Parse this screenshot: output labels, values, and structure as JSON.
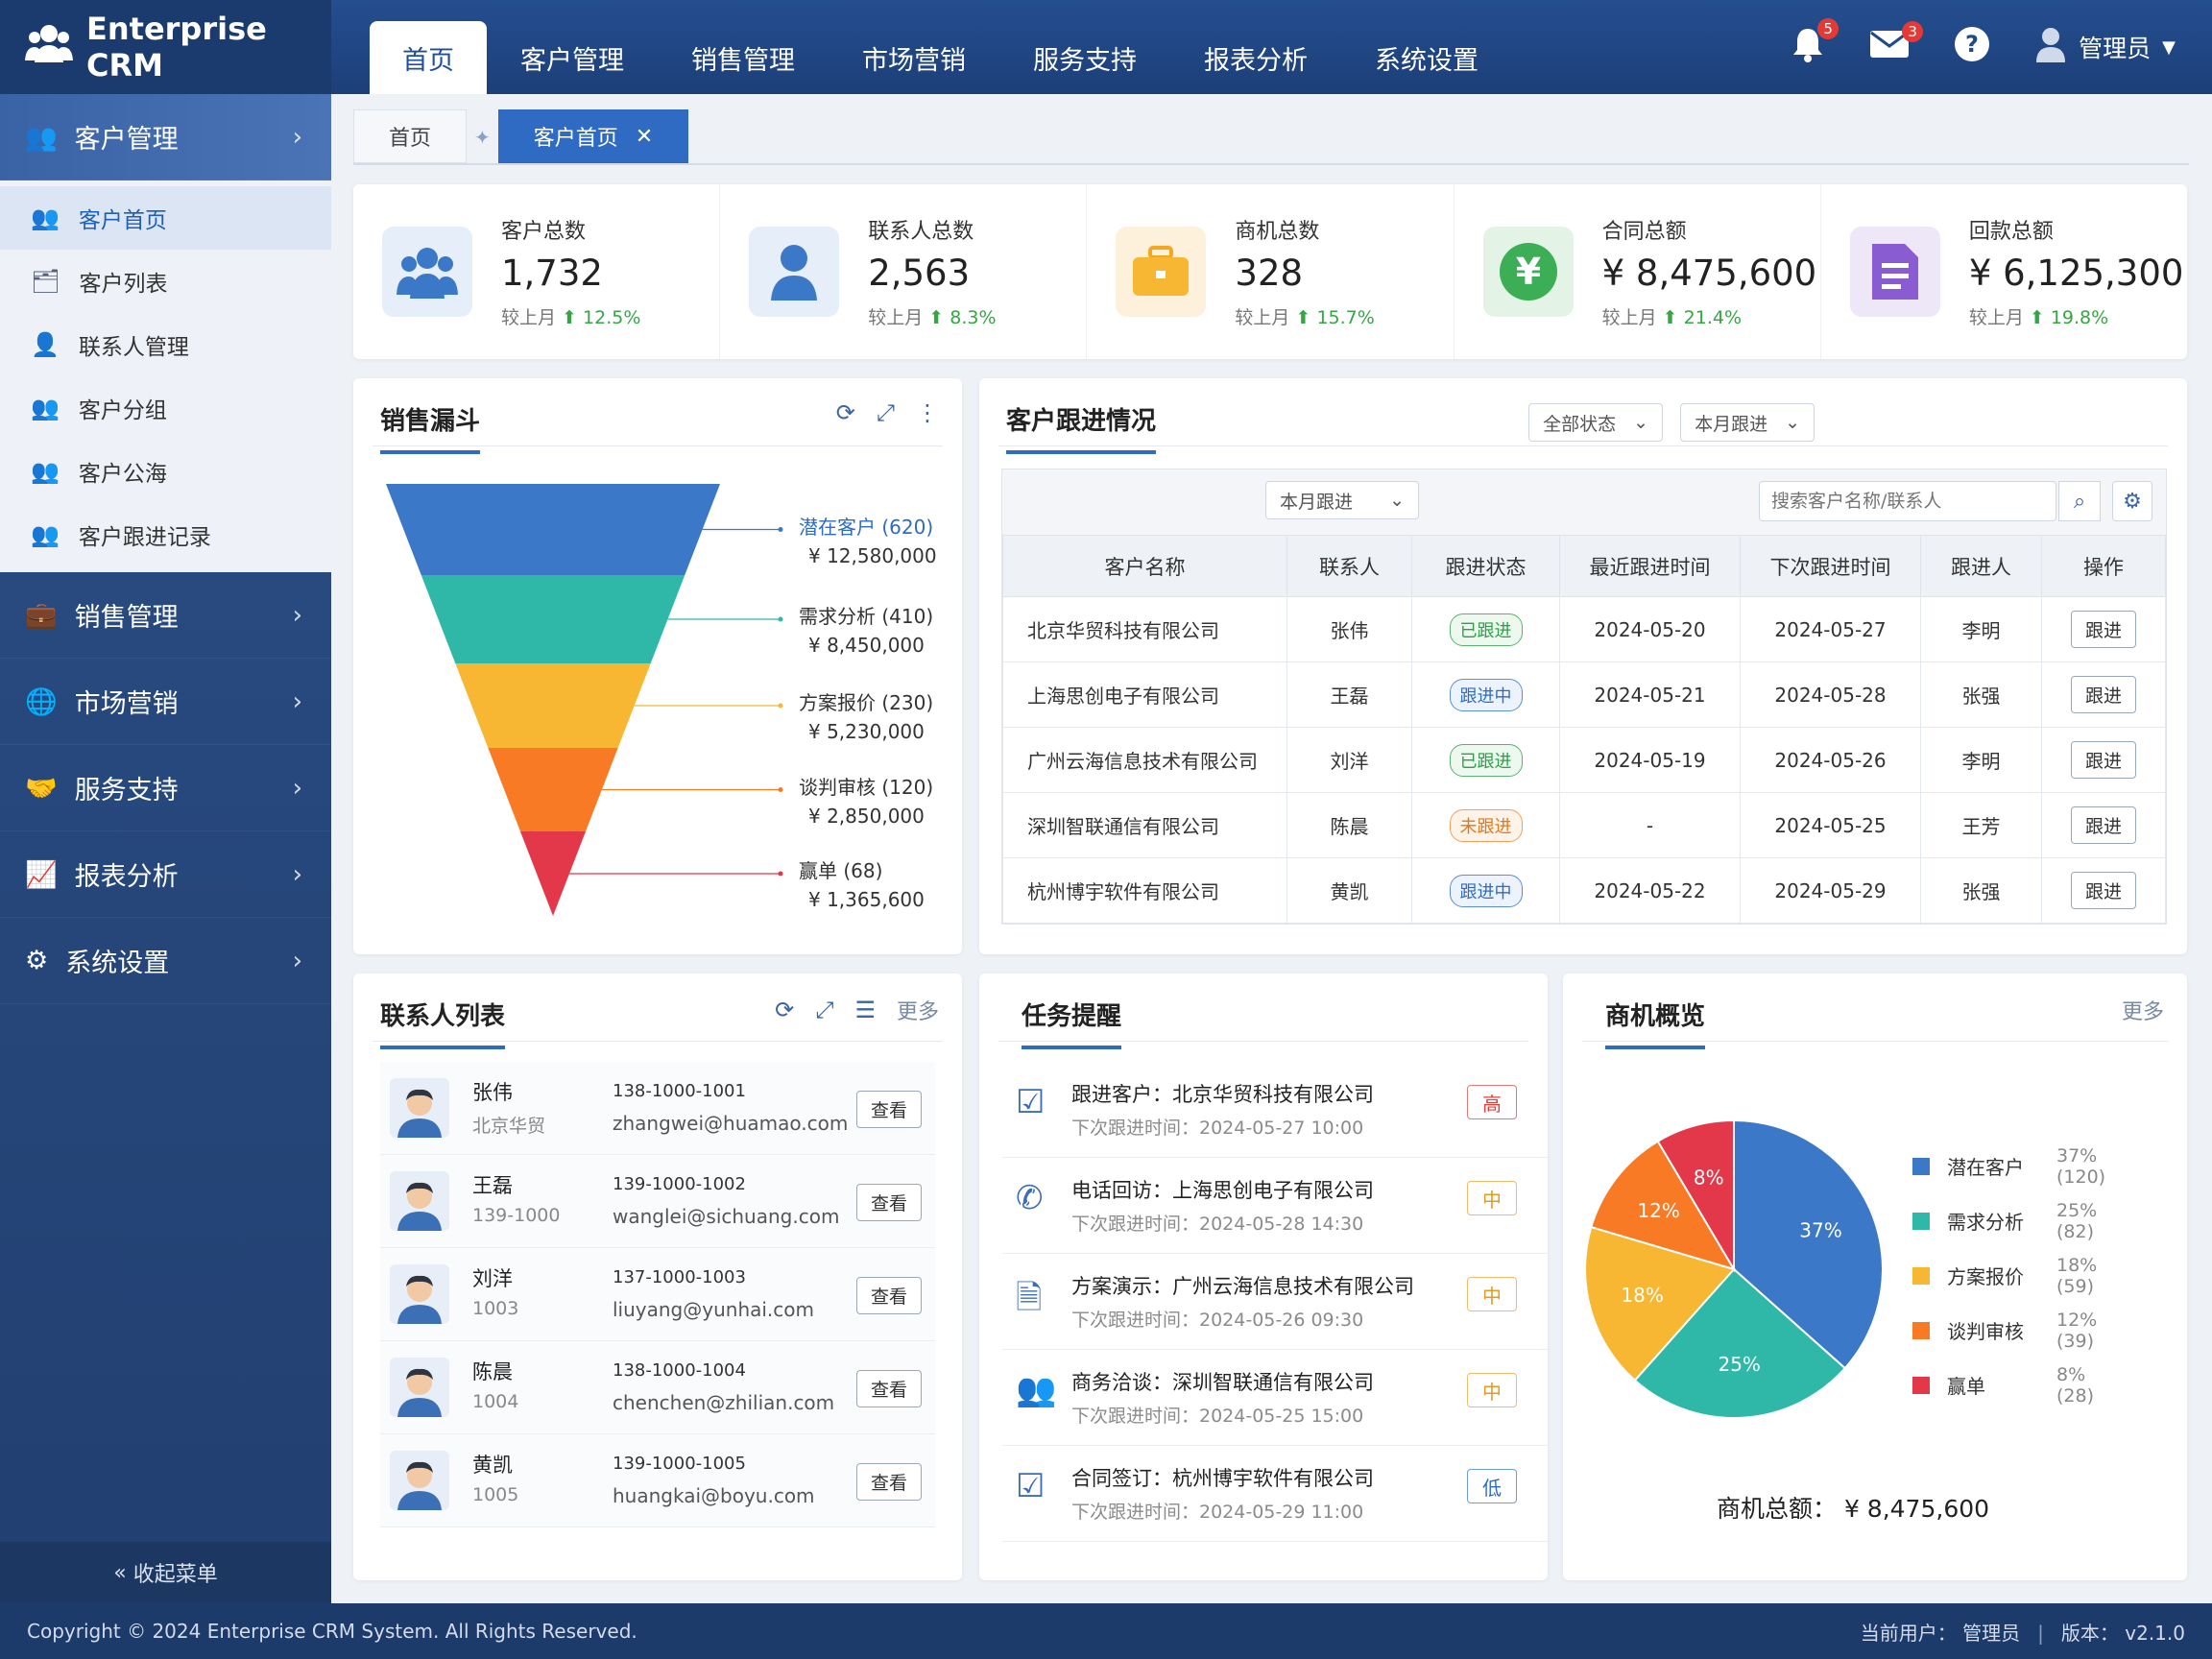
{
  "app": {
    "title": "Enterprise CRM"
  },
  "nav": {
    "items": [
      "首页",
      "客户管理",
      "销售管理",
      "市场营销",
      "服务支持",
      "报表分析",
      "系统设置"
    ]
  },
  "header": {
    "notif_count": "5",
    "mail_count": "3",
    "user": "管理员"
  },
  "sidebar": {
    "groups": [
      "客户管理",
      "销售管理",
      "市场营销",
      "服务支持",
      "报表分析",
      "系统设置"
    ],
    "sub_items": [
      "客户首页",
      "客户列表",
      "联系人管理",
      "客户分组",
      "客户公海",
      "客户跟进记录"
    ],
    "collapse": "收起菜单"
  },
  "tabs": {
    "home": "首页",
    "current": "客户首页"
  },
  "stats": [
    {
      "label": "客户总数",
      "value": "1,732",
      "trend_prefix": "较上月",
      "trend": "12.5%"
    },
    {
      "label": "联系人总数",
      "value": "2,563",
      "trend_prefix": "较上月",
      "trend": "8.3%"
    },
    {
      "label": "商机总数",
      "value": "328",
      "trend_prefix": "较上月",
      "trend": "15.7%"
    },
    {
      "label": "合同总额",
      "value": "¥ 8,475,600",
      "trend_prefix": "较上月",
      "trend": "21.4%"
    },
    {
      "label": "回款总额",
      "value": "¥ 6,125,300",
      "trend_prefix": "较上月",
      "trend": "19.8%"
    }
  ],
  "funnel": {
    "title": "销售漏斗",
    "stages": [
      {
        "label": "潜在客户 (620)",
        "amount": "¥ 12,580,000",
        "color": "#3b78c8"
      },
      {
        "label": "需求分析 (410)",
        "amount": "¥ 8,450,000",
        "color": "#2fb8a8"
      },
      {
        "label": "方案报价 (230)",
        "amount": "¥ 5,230,000",
        "color": "#f7b733"
      },
      {
        "label": "谈判审核 (120)",
        "amount": "¥ 2,850,000",
        "color": "#f97a25"
      },
      {
        "label": "赢单 (68)",
        "amount": "¥ 1,365,600",
        "color": "#e2384a"
      }
    ]
  },
  "followup": {
    "title": "客户跟进情况",
    "filter_status": "全部状态",
    "filter_period": "本月跟进",
    "inner_filter": "本月跟进",
    "search_placeholder": "搜索客户名称/联系人",
    "headers": [
      "客户名称",
      "联系人",
      "跟进状态",
      "最近跟进时间",
      "下次跟进时间",
      "跟进人",
      "操作"
    ],
    "rows": [
      {
        "name": "北京华贸科技有限公司",
        "contact": "张伟",
        "status": "已跟进",
        "stype": "done",
        "last": "2024-05-20",
        "next": "2024-05-27",
        "owner": "李明",
        "action": "跟进"
      },
      {
        "name": "上海思创电子有限公司",
        "contact": "王磊",
        "status": "跟进中",
        "stype": "doing",
        "last": "2024-05-21",
        "next": "2024-05-28",
        "owner": "张强",
        "action": "跟进"
      },
      {
        "name": "广州云海信息技术有限公司",
        "contact": "刘洋",
        "status": "已跟进",
        "stype": "done",
        "last": "2024-05-19",
        "next": "2024-05-26",
        "owner": "李明",
        "action": "跟进"
      },
      {
        "name": "深圳智联通信有限公司",
        "contact": "陈晨",
        "status": "未跟进",
        "stype": "none",
        "last": "-",
        "next": "2024-05-25",
        "owner": "王芳",
        "action": "跟进"
      },
      {
        "name": "杭州博宇软件有限公司",
        "contact": "黄凯",
        "status": "跟进中",
        "stype": "doing",
        "last": "2024-05-22",
        "next": "2024-05-29",
        "owner": "张强",
        "action": "跟进"
      }
    ]
  },
  "contacts": {
    "title": "联系人列表",
    "more": "更多",
    "view_label": "查看",
    "rows": [
      {
        "name": "张伟",
        "sub": "北京华贸",
        "phone": "138-1000-1001",
        "email": "zhangwei@huamao.com"
      },
      {
        "name": "王磊",
        "sub": "139-1000",
        "phone": "139-1000-1002",
        "email": "wanglei@sichuang.com"
      },
      {
        "name": "刘洋",
        "sub": "1003",
        "phone": "137-1000-1003",
        "email": "liuyang@yunhai.com"
      },
      {
        "name": "陈晨",
        "sub": "1004",
        "phone": "138-1000-1004",
        "email": "chenchen@zhilian.com"
      },
      {
        "name": "黄凯",
        "sub": "1005",
        "phone": "139-1000-1005",
        "email": "huangkai@boyu.com"
      }
    ]
  },
  "tasks": {
    "title": "任务提醒",
    "items": [
      {
        "icon": "check-square-icon",
        "title": "跟进客户：北京华贸科技有限公司",
        "time": "下次跟进时间：2024-05-27 10:00",
        "priority": "高",
        "p": "h"
      },
      {
        "icon": "phone-icon",
        "title": "电话回访：上海思创电子有限公司",
        "time": "下次跟进时间：2024-05-28 14:30",
        "priority": "中",
        "p": "m"
      },
      {
        "icon": "document-icon",
        "title": "方案演示：广州云海信息技术有限公司",
        "time": "下次跟进时间：2024-05-26 09:30",
        "priority": "中",
        "p": "m"
      },
      {
        "icon": "people-icon",
        "title": "商务洽谈：深圳智联通信有限公司",
        "time": "下次跟进时间：2024-05-25 15:00",
        "priority": "中",
        "p": "m"
      },
      {
        "icon": "check-square-icon",
        "title": "合同签订：杭州博宇软件有限公司",
        "time": "下次跟进时间：2024-05-29 11:00",
        "priority": "低",
        "p": "l"
      }
    ]
  },
  "opportunity": {
    "title": "商机概览",
    "more": "更多",
    "total": "商机总额： ¥ 8,475,600"
  },
  "chart_data": {
    "type": "pie",
    "categories": [
      "潜在客户",
      "需求分析",
      "方案报价",
      "谈判审核",
      "赢单"
    ],
    "values": [
      120,
      82,
      59,
      39,
      28
    ],
    "percent": [
      37,
      25,
      18,
      12,
      8
    ],
    "colors": [
      "#3b78c8",
      "#2fb8a8",
      "#f7b733",
      "#f97a25",
      "#e2384a"
    ]
  },
  "footer": {
    "copyright": "Copyright © 2024 Enterprise CRM System. All Rights Reserved.",
    "user": "当前用户： 管理员",
    "version": "版本： v2.1.0"
  }
}
